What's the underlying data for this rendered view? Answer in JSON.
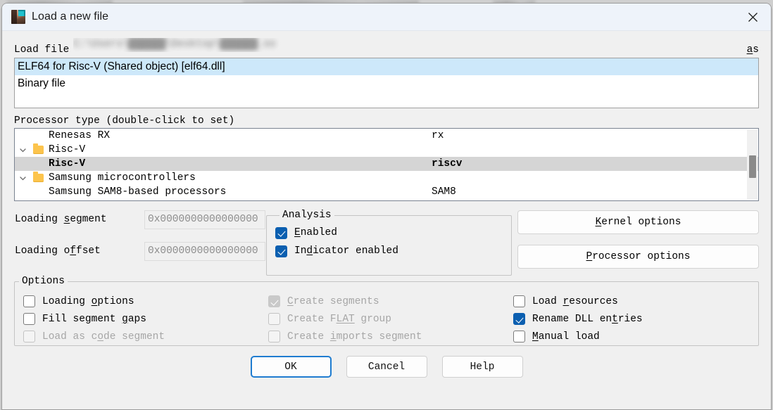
{
  "window": {
    "title": "Load a new file",
    "icon": "ida-app-icon",
    "close_label": "✕"
  },
  "load_file": {
    "label": "Load file",
    "path_redacted": "C:\\Users\\██████\\Desktop\\██████.so",
    "tail": "as"
  },
  "file_types": {
    "items": [
      {
        "label": "ELF64 for Risc-V (Shared object) [elf64.dll]",
        "selected": true
      },
      {
        "label": "Binary file",
        "selected": false
      }
    ]
  },
  "processor": {
    "label": "Processor type (double-click to set)",
    "rows": [
      {
        "name": "Renesas RX",
        "code": "rx",
        "kind": "leaf",
        "indent": 1,
        "selected": false
      },
      {
        "name": "Risc-V",
        "code": "",
        "kind": "folder",
        "indent": 0,
        "selected": false
      },
      {
        "name": "Risc-V",
        "code": "riscv",
        "kind": "leaf",
        "indent": 1,
        "selected": true
      },
      {
        "name": "Samsung microcontrollers",
        "code": "",
        "kind": "folder",
        "indent": 0,
        "selected": false
      },
      {
        "name": "Samsung SAM8-based processors",
        "code": "SAM8",
        "kind": "leaf",
        "indent": 1,
        "selected": false
      }
    ]
  },
  "loading": {
    "segment_label": "Loading segment",
    "segment_value": "0x0000000000000000",
    "offset_label": "Loading offset",
    "offset_value": "0x0000000000000000"
  },
  "analysis": {
    "legend": "Analysis",
    "items": [
      {
        "label": "Enabled",
        "checked": true,
        "disabled": false
      },
      {
        "label": "Indicator enabled",
        "checked": true,
        "disabled": false
      }
    ]
  },
  "side_buttons": [
    {
      "label": "Kernel options"
    },
    {
      "label": "Processor options"
    }
  ],
  "options": {
    "legend": "Options",
    "column1": [
      {
        "label": "Loading options",
        "checked": false,
        "disabled": false
      },
      {
        "label": "Fill segment gaps",
        "checked": false,
        "disabled": false
      },
      {
        "label": "Load as code segment",
        "checked": false,
        "disabled": true
      }
    ],
    "column2": [
      {
        "label": "Create segments",
        "checked": true,
        "disabled": true
      },
      {
        "label": "Create FLAT group",
        "checked": false,
        "disabled": true
      },
      {
        "label": "Create imports segment",
        "checked": false,
        "disabled": true
      }
    ],
    "column3": [
      {
        "label": "Load resources",
        "checked": false,
        "disabled": false
      },
      {
        "label": "Rename DLL entries",
        "checked": true,
        "disabled": false
      },
      {
        "label": "Manual load",
        "checked": false,
        "disabled": false
      }
    ]
  },
  "footer": {
    "ok": "OK",
    "cancel": "Cancel",
    "help": "Help"
  },
  "colors": {
    "accent_checkbox": "#0b5fb0",
    "list_selection": "#cde8fa",
    "tree_selection": "#d5d5d5",
    "default_button_border": "#1f7cd0",
    "folder": "#fcc44d"
  }
}
